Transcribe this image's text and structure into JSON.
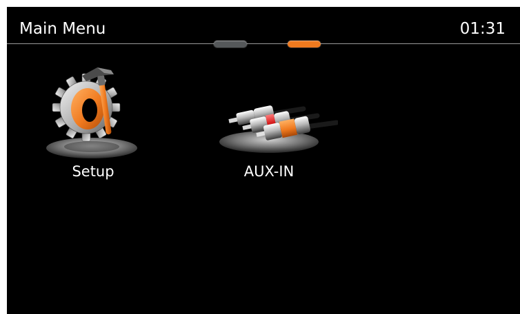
{
  "header": {
    "title": "Main Menu",
    "clock": "01:31"
  },
  "pager": {
    "pages": 2,
    "current_page": 2,
    "inactive_color": "#55585a",
    "active_color": "#f07a1f"
  },
  "menu": {
    "items": [
      {
        "label": "Setup",
        "icon": "gear-hammer-icon"
      },
      {
        "label": "AUX-IN",
        "icon": "rca-cables-icon"
      }
    ]
  },
  "colors": {
    "background": "#000000",
    "accent": "#f07a1f",
    "text": "#ffffff"
  }
}
